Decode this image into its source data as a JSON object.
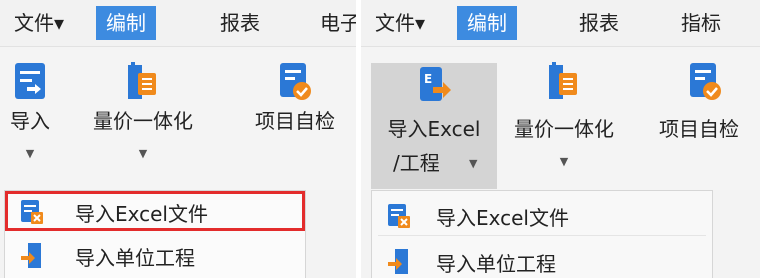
{
  "left": {
    "menus": [
      "文件▾",
      "编制",
      "报表",
      "电子"
    ],
    "buttons": {
      "import": "导入",
      "pricing": "量价一体化",
      "self_check": "项目自检"
    },
    "dropdown": [
      "导入Excel文件",
      "导入单位工程"
    ]
  },
  "right": {
    "menus": [
      "文件▾",
      "编制",
      "报表",
      "指标"
    ],
    "buttons": {
      "import_line1": "导入Excel",
      "import_line2": "/工程",
      "pricing": "量价一体化",
      "self_check": "项目自检"
    },
    "dropdown": [
      "导入Excel文件",
      "导入单位工程"
    ]
  },
  "colors": {
    "accent": "#3d8be0",
    "highlight": "#e32c2c",
    "icon_blue": "#2b78d6",
    "icon_orange": "#f08a1c"
  }
}
